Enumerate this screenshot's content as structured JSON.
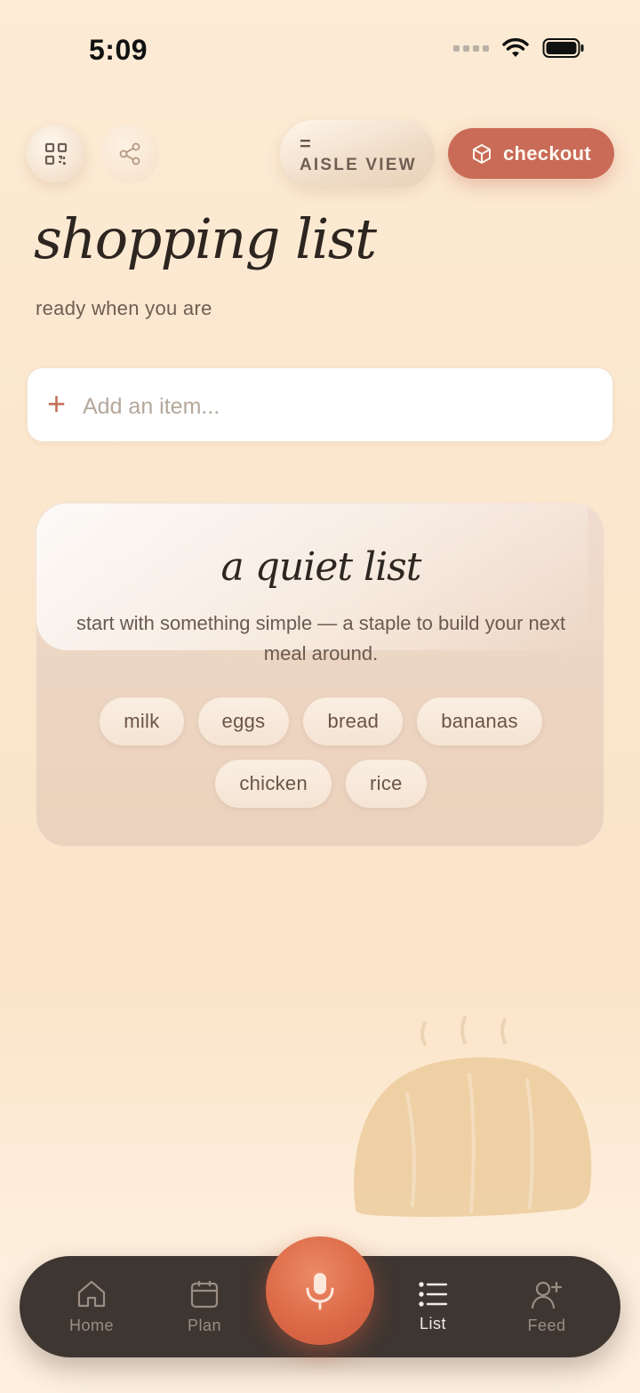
{
  "status_bar": {
    "time": "5:09"
  },
  "toolbar": {
    "qr_icon": "qr-code-icon",
    "share_icon": "share-icon",
    "aisle_view_icon": "equals-icon",
    "aisle_view_symbol": "=",
    "aisle_view_label": "AISLE VIEW",
    "checkout_icon": "box-icon",
    "checkout_label": "checkout"
  },
  "header": {
    "title": "shopping list",
    "subtitle": "ready when you are"
  },
  "add_item": {
    "icon": "plus-icon",
    "placeholder": "Add an item..."
  },
  "empty_state": {
    "title": "a quiet list",
    "text": "start with something simple — a staple to build your next meal around.",
    "suggestions": [
      "milk",
      "eggs",
      "bread",
      "bananas",
      "chicken",
      "rice"
    ]
  },
  "tab_bar": {
    "tabs": [
      {
        "label": "Home",
        "icon": "home-icon",
        "active": false
      },
      {
        "label": "Plan",
        "icon": "calendar-icon",
        "active": false
      },
      {
        "label": "List",
        "icon": "list-icon",
        "active": true
      },
      {
        "label": "Feed",
        "icon": "add-person-icon",
        "active": false
      }
    ],
    "center_button_icon": "microphone-icon"
  },
  "colors": {
    "accent": "#c96b57",
    "mic": "#dc6a48",
    "tab_bar_bg": "#3e3631",
    "background": "#fbe6cd"
  }
}
